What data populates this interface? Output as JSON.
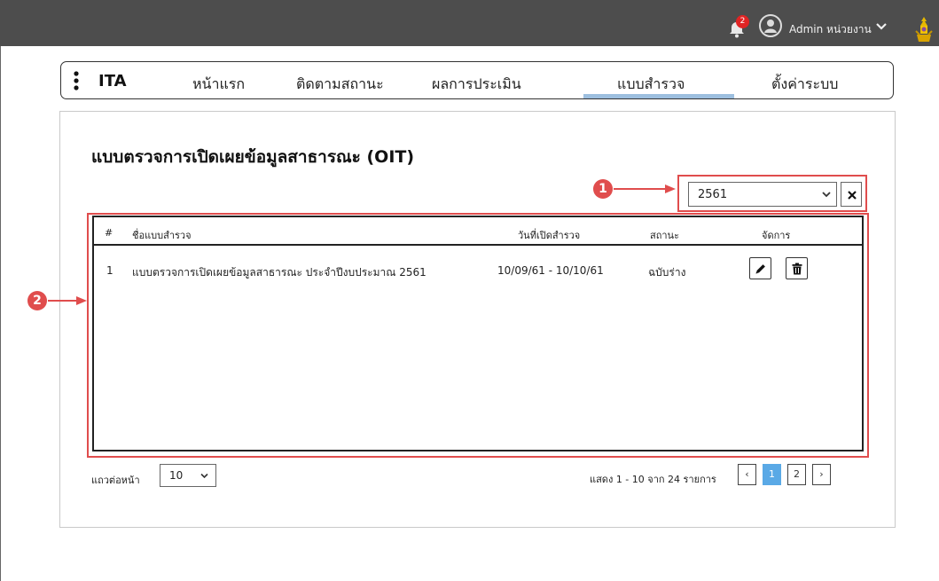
{
  "header": {
    "notification_count": "2",
    "user_label": "Admin หน่วยงาน",
    "colors": {
      "bar": "#4d4d4d",
      "badge": "#e02424"
    }
  },
  "nav": {
    "brand": "ITA",
    "items": [
      {
        "label": "หน้าแรก"
      },
      {
        "label": "ติดตามสถานะ"
      },
      {
        "label": "ผลการประเมิน"
      },
      {
        "label": "แบบสำรวจ",
        "active": true
      },
      {
        "label": "ตั้งค่าระบบ"
      }
    ],
    "active_color": "#9dbfdf"
  },
  "page": {
    "title": "แบบตรวจการเปิดเผยข้อมูลสาธารณะ (OIT)"
  },
  "filter": {
    "year_value": "2561"
  },
  "table": {
    "headers": {
      "index": "#",
      "name": "ชื่อแบบสำรวจ",
      "date": "วันที่เปิดสำรวจ",
      "status": "สถานะ",
      "actions": "จัดการ"
    },
    "rows": [
      {
        "index": "1",
        "name": "แบบตรวจการเปิดเผยข้อมูลสาธารณะ ประจำปีงบประมาณ 2561",
        "date": "10/09/61 - 10/10/61",
        "status": "ฉบับร่าง"
      }
    ]
  },
  "pagination": {
    "rows_label": "แถวต่อหน้า",
    "rows_value": "10",
    "summary": "แสดง 1 - 10 จาก 24 รายการ",
    "prev": "‹",
    "pages": [
      "1",
      "2"
    ],
    "next": "›",
    "active_color": "#5aa9e6"
  },
  "callouts": {
    "one": "1",
    "two": "2",
    "color": "#e04d4d"
  }
}
